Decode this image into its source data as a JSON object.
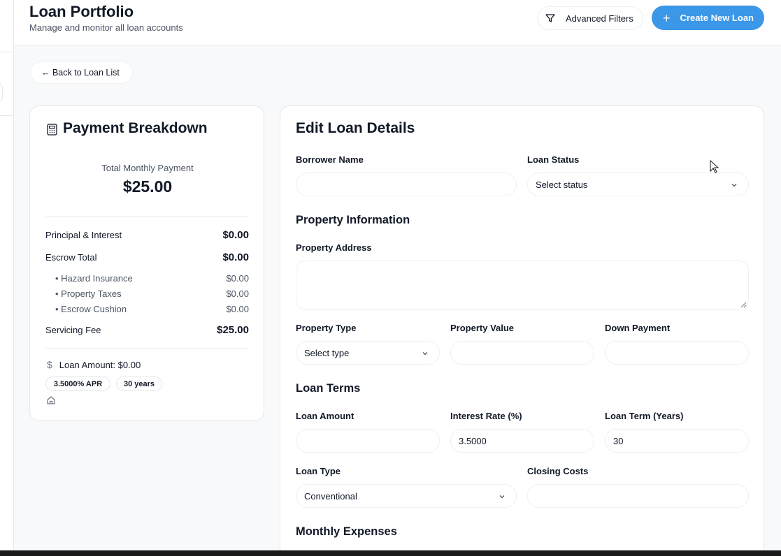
{
  "header": {
    "title": "Loan Portfolio",
    "subtitle": "Manage and monitor all loan accounts",
    "filters_label": "Advanced Filters",
    "create_label": "Create New Loan"
  },
  "back_label": "← Back to Loan List",
  "payment": {
    "title": "Payment Breakdown",
    "total_label": "Total Monthly Payment",
    "total_value": "$25.00",
    "principal_label": "Principal & Interest",
    "principal_value": "$0.00",
    "escrow_label": "Escrow Total",
    "escrow_value": "$0.00",
    "sub_items": [
      {
        "label": "• Hazard Insurance",
        "value": "$0.00"
      },
      {
        "label": "• Property Taxes",
        "value": "$0.00"
      },
      {
        "label": "• Escrow Cushion",
        "value": "$0.00"
      }
    ],
    "fee_label": "Servicing Fee",
    "fee_value": "$25.00",
    "loan_amount": "Loan Amount: $0.00",
    "apr_badge": "3.5000% APR",
    "term_badge": "30 years"
  },
  "edit": {
    "title": "Edit Loan Details",
    "borrower_label": "Borrower Name",
    "borrower_value": "",
    "status_label": "Loan Status",
    "status_value": "Select status",
    "property_section": "Property Information",
    "address_label": "Property Address",
    "address_value": "",
    "ptype_label": "Property Type",
    "ptype_value": "Select type",
    "pvalue_label": "Property Value",
    "pvalue_value": "",
    "down_label": "Down Payment",
    "down_value": "",
    "terms_section": "Loan Terms",
    "amount_label": "Loan Amount",
    "amount_value": "",
    "rate_label": "Interest Rate (%)",
    "rate_value": "3.5000",
    "term_label": "Loan Term (Years)",
    "term_value": "30",
    "ltype_label": "Loan Type",
    "ltype_value": "Conventional",
    "closing_label": "Closing Costs",
    "closing_value": "",
    "expenses_section": "Monthly Expenses"
  },
  "colors": {
    "accent": "#3b97e8",
    "text": "#111827",
    "muted": "#4b5563",
    "border": "#e5e7eb",
    "background": "#f8f9fa"
  }
}
